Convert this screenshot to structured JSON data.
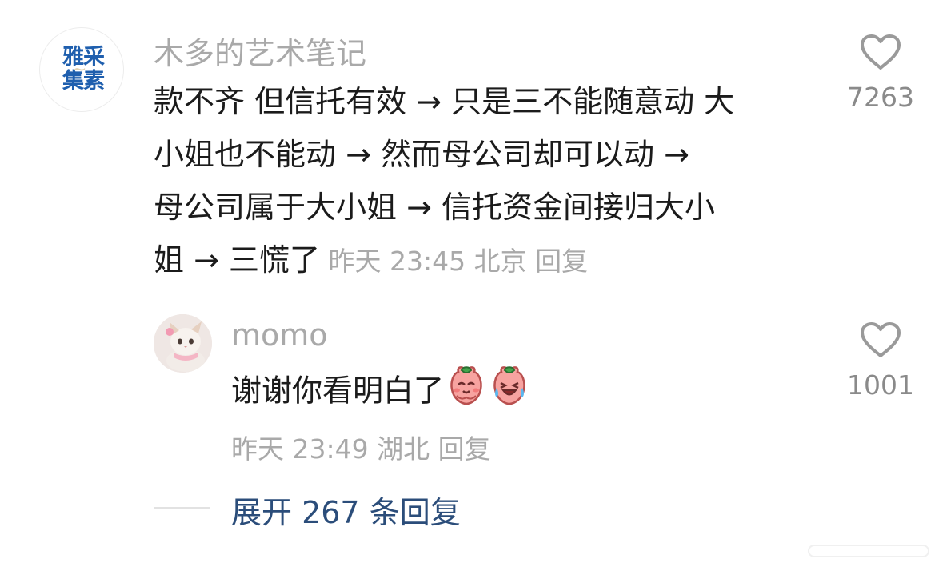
{
  "comment": {
    "username": "木多的艺术笔记",
    "text_lines": [
      "款不齐 但信托有效 → 只是三不能随意动 大",
      "小姐也不能动  →  然而母公司却可以动  →",
      "母公司属于大小姐  →  信托资金间接归大小",
      "姐  → 三慌了"
    ],
    "meta": {
      "time": "昨天 23:45",
      "location": "北京",
      "reply": "回复"
    },
    "likes": "7263",
    "avatar_logo_text": [
      "雅采",
      "集素"
    ]
  },
  "reply": {
    "username": "momo",
    "text": "谢谢你看明白了",
    "emojis": [
      "peach-pleading-emoji",
      "peach-laugh-cry-emoji"
    ],
    "meta": {
      "time": "昨天 23:49",
      "location": "湖北",
      "reply": "回复"
    },
    "likes": "1001"
  },
  "expand": {
    "label": "展开 267 条回复"
  },
  "colors": {
    "text": "#1b1b1b",
    "muted": "#a9a9a9",
    "link": "#2b4d7a",
    "logo_blue": "#1f5fae"
  }
}
